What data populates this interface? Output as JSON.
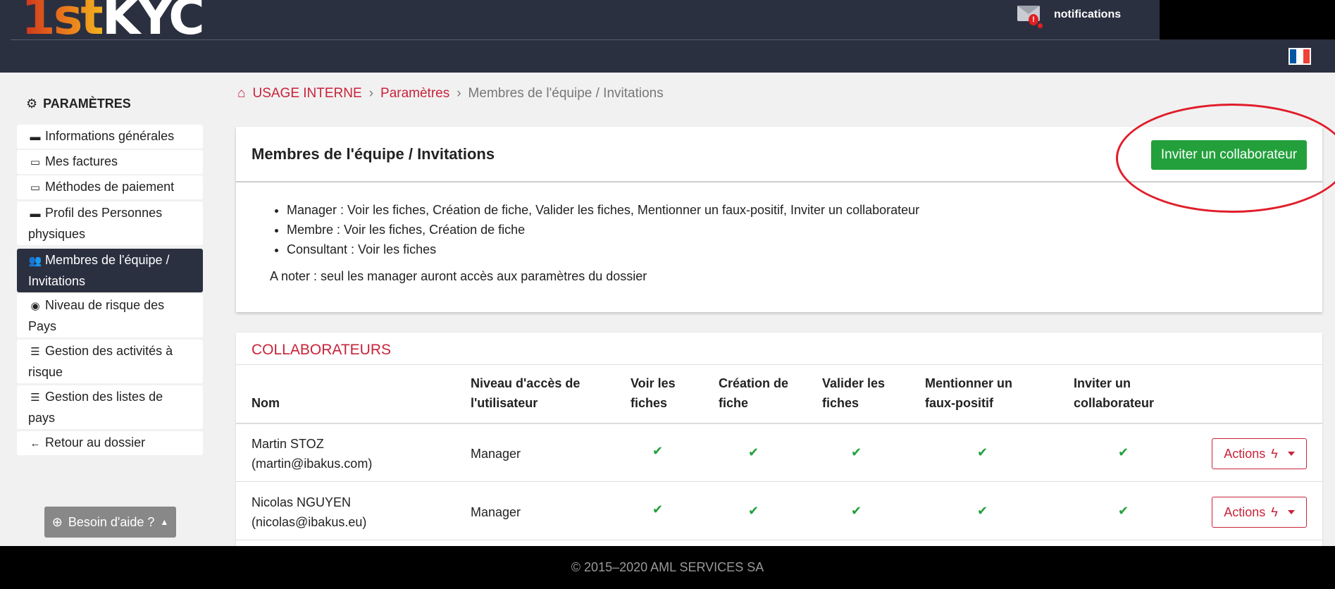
{
  "header": {
    "logo_first": "1st",
    "logo_second": "KYC",
    "notifications_label": "notifications",
    "notifications_badge": "!",
    "flag_colors": [
      "#0055a4",
      "#ffffff",
      "#ef4135"
    ]
  },
  "sidebar": {
    "title": "PARAMÈTRES",
    "items": [
      {
        "label": "Informations générales",
        "icon": "folder-icon"
      },
      {
        "label": "Mes factures",
        "icon": "credit-card-icon"
      },
      {
        "label": "Méthodes de paiement",
        "icon": "credit-card-icon"
      },
      {
        "label": "Profil des Personnes physiques",
        "icon": "folder-icon"
      },
      {
        "label": "Membres de l'équipe / Invitations",
        "icon": "users-icon",
        "active": true
      },
      {
        "label": "Niveau de risque des Pays",
        "icon": "globe-icon"
      },
      {
        "label": "Gestion des activités à risque",
        "icon": "list-icon"
      },
      {
        "label": "Gestion des listes de pays",
        "icon": "list-icon"
      },
      {
        "label": "Retour au dossier",
        "icon": "arrow-left-icon"
      }
    ],
    "help_label": "Besoin d'aide ?"
  },
  "breadcrumb": {
    "home": "USAGE INTERNE",
    "parent": "Paramètres",
    "current": "Membres de l'équipe / Invitations"
  },
  "roles_card": {
    "title": "Membres de l'équipe / Invitations",
    "invite_button": "Inviter un collaborateur",
    "roles": [
      "Manager : Voir les fiches, Création de fiche, Valider les fiches, Mentionner un faux-positif, Inviter un collaborateur",
      "Membre : Voir les fiches, Création de fiche",
      "Consultant : Voir les fiches"
    ],
    "note": "A noter : seul les manager auront accès aux paramètres du dossier"
  },
  "collaborators": {
    "title": "COLLABORATEURS",
    "columns": [
      "Nom",
      "Niveau d'accès de l'utilisateur",
      "Voir les fiches",
      "Création de fiche",
      "Valider les fiches",
      "Mentionner un faux-positif",
      "Inviter un collaborateur"
    ],
    "rows": [
      {
        "name": "Martin STOZ",
        "email": "(martin@ibakus.com)",
        "level": "Manager",
        "actions": "Actions"
      },
      {
        "name": "Nicolas NGUYEN",
        "email": "(nicolas@ibakus.eu)",
        "level": "Manager",
        "actions": "Actions"
      }
    ]
  },
  "footer": {
    "text": "© 2015–2020 AML SERVICES SA"
  },
  "colors": {
    "header_bg": "#2b3040",
    "accent_red": "#c8233a",
    "success_green": "#23a03c",
    "annotation_red": "#e01e2a"
  }
}
